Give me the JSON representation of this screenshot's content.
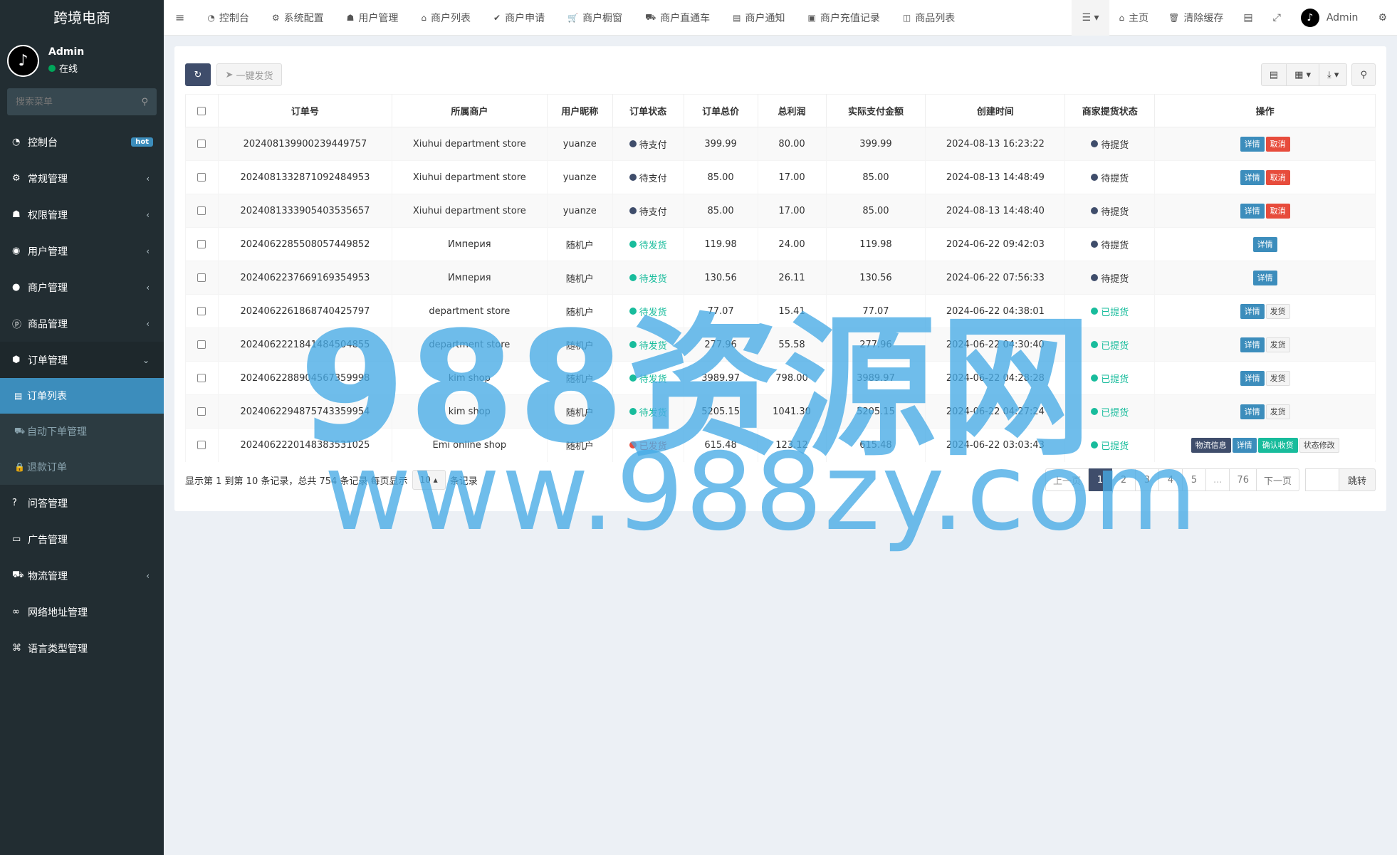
{
  "brand": "跨境电商",
  "user": {
    "name": "Admin",
    "status": "在线"
  },
  "sidebar_search": {
    "placeholder": "搜索菜单"
  },
  "menu": [
    {
      "icon": "dashboard-icon",
      "glyph": "◔",
      "label": "控制台",
      "badge": "hot"
    },
    {
      "icon": "cogs-icon",
      "glyph": "⚙",
      "label": "常规管理",
      "chevron": "‹"
    },
    {
      "icon": "group-icon",
      "glyph": "☗",
      "label": "权限管理",
      "chevron": "‹"
    },
    {
      "icon": "user-circle-icon",
      "glyph": "◉",
      "label": "用户管理",
      "chevron": "‹"
    },
    {
      "icon": "apple-icon",
      "glyph": "●",
      "label": "商户管理",
      "chevron": "‹"
    },
    {
      "icon": "product-hunt-icon",
      "glyph": "ⓟ",
      "label": "商品管理",
      "chevron": "‹"
    },
    {
      "icon": "cube-icon",
      "glyph": "⬢",
      "label": "订单管理",
      "chevron": "⌄"
    }
  ],
  "submenu": [
    {
      "icon": "list-icon",
      "glyph": "▤",
      "label": "订单列表"
    },
    {
      "icon": "car-icon",
      "glyph": "⛟",
      "label": "自动下单管理"
    },
    {
      "icon": "lock-icon",
      "glyph": "🔒",
      "label": "退款订单"
    }
  ],
  "menu2": [
    {
      "icon": "question-icon",
      "glyph": "?",
      "label": "问答管理"
    },
    {
      "icon": "ad-icon",
      "glyph": "▭",
      "label": "广告管理"
    },
    {
      "icon": "truck-icon",
      "glyph": "⛟",
      "label": "物流管理",
      "chevron": "‹"
    },
    {
      "icon": "link-icon",
      "glyph": "∞",
      "label": "网络地址管理"
    },
    {
      "icon": "language-icon",
      "glyph": "⌘",
      "label": "语言类型管理"
    }
  ],
  "topnav": [
    {
      "icon": "dashboard-icon",
      "glyph": "◔",
      "label": "控制台"
    },
    {
      "icon": "cog-icon",
      "glyph": "⚙",
      "label": "系统配置"
    },
    {
      "icon": "user-icon",
      "glyph": "☗",
      "label": "用户管理"
    },
    {
      "icon": "home-icon",
      "glyph": "⌂",
      "label": "商户列表"
    },
    {
      "icon": "check-circle-icon",
      "glyph": "✔",
      "label": "商户申请"
    },
    {
      "icon": "cart-icon",
      "glyph": "🛒",
      "label": "商户橱窗"
    },
    {
      "icon": "car-icon",
      "glyph": "⛟",
      "label": "商户直通车"
    },
    {
      "icon": "notice-icon",
      "glyph": "▤",
      "label": "商户通知"
    },
    {
      "icon": "money-icon",
      "glyph": "▣",
      "label": "商户充值记录"
    },
    {
      "icon": "shopping-bag-icon",
      "glyph": "◫",
      "label": "商品列表"
    }
  ],
  "topright": {
    "home": "主页",
    "clear_cache": "清除缓存",
    "admin": "Admin"
  },
  "toolbar": {
    "ship_all": "一键发货"
  },
  "table": {
    "headers": [
      "订单号",
      "所属商户",
      "用户昵称",
      "订单状态",
      "订单总价",
      "总利润",
      "实际支付金额",
      "创建时间",
      "商家提货状态",
      "操作"
    ],
    "rows": [
      {
        "order_no": "202408139900239449757",
        "merchant": "Xiuhui department store",
        "user": "yuanze",
        "status": "待支付",
        "status_color": "dark",
        "total": "399.99",
        "profit": "80.00",
        "paid": "399.99",
        "created": "2024-08-13 16:23:22",
        "pickup": "待提货",
        "pickup_color": "dark",
        "actions": [
          {
            "label": "详情",
            "style": "blue"
          },
          {
            "label": "取消",
            "style": "red"
          }
        ]
      },
      {
        "order_no": "202408133287109248495​3",
        "merchant": "Xiuhui department store",
        "user": "yuanze",
        "status": "待支付",
        "status_color": "dark",
        "total": "85.00",
        "profit": "17.00",
        "paid": "85.00",
        "created": "2024-08-13 14:48:49",
        "pickup": "待提货",
        "pickup_color": "dark",
        "actions": [
          {
            "label": "详情",
            "style": "blue"
          },
          {
            "label": "取消",
            "style": "red"
          }
        ]
      },
      {
        "order_no": "202408133390540353565​7",
        "merchant": "Xiuhui department store",
        "user": "yuanze",
        "status": "待支付",
        "status_color": "dark",
        "total": "85.00",
        "profit": "17.00",
        "paid": "85.00",
        "created": "2024-08-13 14:48:40",
        "pickup": "待提货",
        "pickup_color": "dark",
        "actions": [
          {
            "label": "详情",
            "style": "blue"
          },
          {
            "label": "取消",
            "style": "red"
          }
        ]
      },
      {
        "order_no": "202406228550805744985​2",
        "merchant": "Империя",
        "user": "随机户",
        "status": "待发货",
        "status_color": "green",
        "total": "119.98",
        "profit": "24.00",
        "paid": "119.98",
        "created": "2024-06-22 09:42:03",
        "pickup": "待提货",
        "pickup_color": "dark",
        "actions": [
          {
            "label": "详情",
            "style": "blue"
          }
        ]
      },
      {
        "order_no": "202406223766916935495​3",
        "merchant": "Империя",
        "user": "随机户",
        "status": "待发货",
        "status_color": "green",
        "total": "130.56",
        "profit": "26.11",
        "paid": "130.56",
        "created": "2024-06-22 07:56:33",
        "pickup": "待提货",
        "pickup_color": "dark",
        "actions": [
          {
            "label": "详情",
            "style": "blue"
          }
        ]
      },
      {
        "order_no": "202406226186874042579​7",
        "merchant": "department store",
        "user": "随机户",
        "status": "待发货",
        "status_color": "green",
        "total": "77.07",
        "profit": "15.41",
        "paid": "77.07",
        "created": "2024-06-22 04:38:01",
        "pickup": "已提货",
        "pickup_color": "green",
        "actions": [
          {
            "label": "详情",
            "style": "blue"
          },
          {
            "label": "发货",
            "style": "grey"
          }
        ]
      },
      {
        "order_no": "202406222184148450485​5",
        "merchant": "department store",
        "user": "随机户",
        "status": "待发货",
        "status_color": "green",
        "total": "277.96",
        "profit": "55.58",
        "paid": "277.96",
        "created": "2024-06-22 04:30:40",
        "pickup": "已提货",
        "pickup_color": "green",
        "actions": [
          {
            "label": "详情",
            "style": "blue"
          },
          {
            "label": "发货",
            "style": "grey"
          }
        ]
      },
      {
        "order_no": "202406228890456735999​8",
        "merchant": "kim shop",
        "user": "随机户",
        "status": "待发货",
        "status_color": "green",
        "total": "3989.97",
        "profit": "798.00",
        "paid": "3989.97",
        "created": "2024-06-22 04:28:28",
        "pickup": "已提货",
        "pickup_color": "green",
        "actions": [
          {
            "label": "详情",
            "style": "blue"
          },
          {
            "label": "发货",
            "style": "grey"
          }
        ]
      },
      {
        "order_no": "202406229487574335995​4",
        "merchant": "kim shop",
        "user": "随机户",
        "status": "待发货",
        "status_color": "green",
        "total": "5205.15",
        "profit": "1041.30",
        "paid": "5205.15",
        "created": "2024-06-22 04:27:24",
        "pickup": "已提货",
        "pickup_color": "green",
        "actions": [
          {
            "label": "详情",
            "style": "blue"
          },
          {
            "label": "发货",
            "style": "grey"
          }
        ]
      },
      {
        "order_no": "202406222014838353102​5",
        "merchant": "Emi online shop",
        "user": "随机户",
        "status": "已发货",
        "status_color": "red",
        "total": "615.48",
        "profit": "123.12",
        "paid": "615.48",
        "created": "2024-06-22 03:03:43",
        "pickup": "已提货",
        "pickup_color": "green",
        "actions": [
          {
            "label": "物流信息",
            "style": "dark"
          },
          {
            "label": "详情",
            "style": "blue"
          },
          {
            "label": "确认收货",
            "style": "green"
          },
          {
            "label": "状态修改",
            "style": "grey"
          }
        ]
      }
    ]
  },
  "footer": {
    "summary_pre": "显示第 1 到第 10 条记录，总共 754 条记录 每页显示",
    "page_size": "10",
    "summary_post": "条记录",
    "prev": "上一页",
    "pages": [
      "1",
      "2",
      "3",
      "4",
      "5",
      "...",
      "76"
    ],
    "active_page": "1",
    "next": "下一页",
    "jump": "跳转"
  },
  "watermark": {
    "big": "988资源网",
    "url": "www.988zy.com"
  }
}
